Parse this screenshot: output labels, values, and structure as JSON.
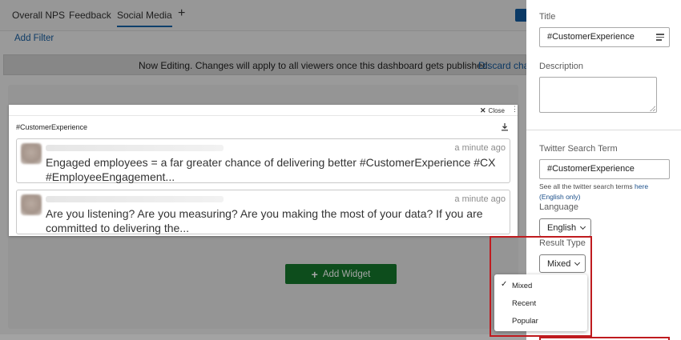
{
  "tabs": [
    "Overall NPS",
    "Feedback",
    "Social Media"
  ],
  "tab_add": "+",
  "filter": {
    "add_label": "Add Filter"
  },
  "banner": {
    "text": "Now Editing. Changes will apply to all viewers once this dashboard gets published.",
    "link": "Discard chan"
  },
  "add_widget": {
    "label": "Add Widget",
    "plus": "+"
  },
  "widget": {
    "close_label": "Close",
    "close_glyph": "✕",
    "menu_glyph": "⋮",
    "title": "#CustomerExperience",
    "tweets": [
      {
        "time": "a minute ago",
        "text": "Engaged employees = a far greater chance of delivering better #CustomerExperience #CX #EmployeeEngagement..."
      },
      {
        "time": "a minute ago",
        "text": "Are you listening? Are you measuring? Are you making the most of your data? If you are committed to delivering the..."
      }
    ]
  },
  "panel": {
    "title_label": "Title",
    "title_value": "#CustomerExperience",
    "description_label": "Description",
    "search_label": "Twitter Search Term",
    "search_value": "#CustomerExperience",
    "hint_text": "See all the twitter search terms ",
    "hint_link": "here",
    "hint_link2": "(English only)",
    "language_label": "Language",
    "language_value": "English",
    "result_type_label": "Result Type",
    "result_type_value": "Mixed"
  },
  "dropdown": {
    "options": [
      "Mixed",
      "Recent",
      "Popular"
    ],
    "selected_check": "✓"
  },
  "colors": {
    "accent_red": "#bf1b1f",
    "add_widget_green": "#0d4d1c",
    "link_blue": "#1b4f8a"
  }
}
